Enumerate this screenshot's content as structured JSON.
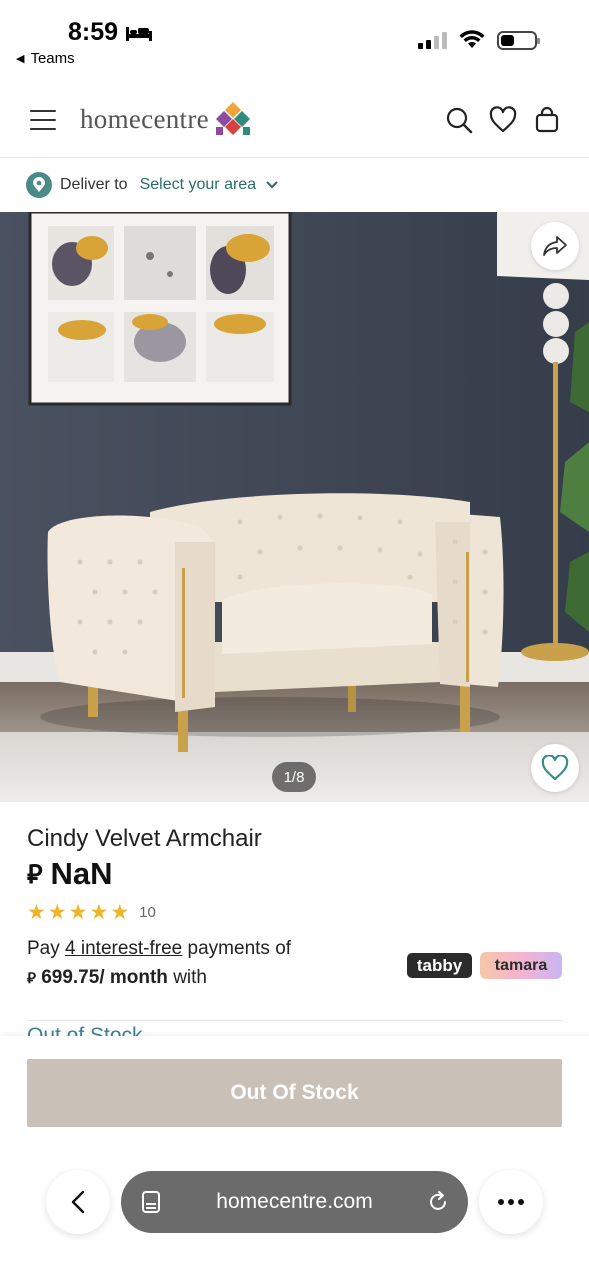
{
  "status_bar": {
    "time": "8:59",
    "back_app": "Teams",
    "battery_level_percent": 40
  },
  "header": {
    "logo_text": "homecentre",
    "icons": [
      "menu-icon",
      "search-icon",
      "heart-icon",
      "bag-icon"
    ]
  },
  "delivery": {
    "label": "Deliver to",
    "link": "Select your area"
  },
  "gallery": {
    "pager": "1/8"
  },
  "product": {
    "title": "Cindy Velvet Armchair",
    "currency_symbol": "⃁",
    "price": "NaN",
    "rating_stars": 5,
    "rating_count": "10",
    "pay_prefix": "Pay ",
    "pay_link": "4 interest-free",
    "pay_suffix": " payments of",
    "installment": "699.75/ month",
    "with_text": " with",
    "providers": [
      "tabby",
      "tamara"
    ],
    "stock_label_peek": "Out of Stock"
  },
  "actions": {
    "out_of_stock_button": "Out Of Stock"
  },
  "browser": {
    "url": "homecentre.com"
  },
  "colors": {
    "accent_teal": "#2c6e6a",
    "star": "#f0b429",
    "button_disabled": "#c9c1b8"
  }
}
